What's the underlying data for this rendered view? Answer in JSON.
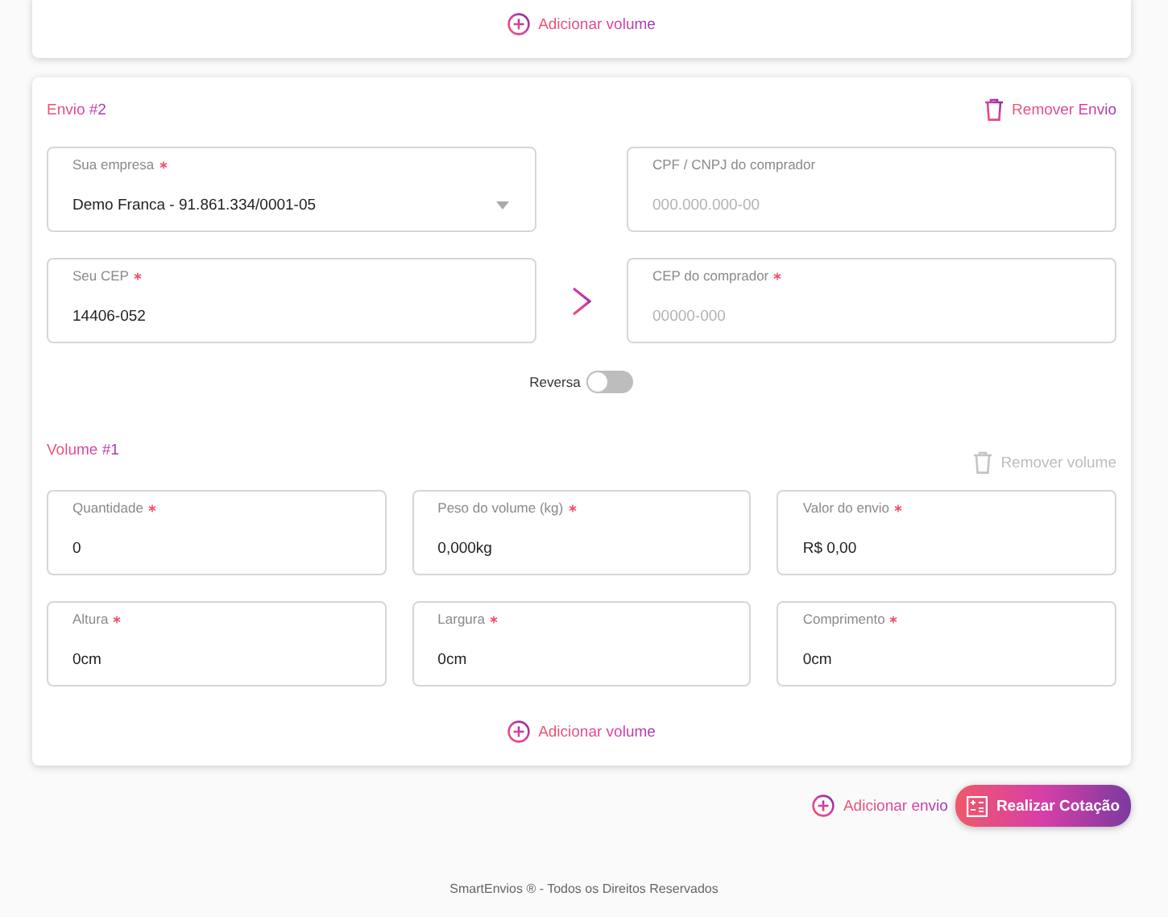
{
  "previous_card": {
    "add_volume": "Adicionar volume"
  },
  "shipment": {
    "title": "Envio #2",
    "remove": "Remover Envio",
    "route": [
      {
        "kind": "select",
        "label": "Sua empresa",
        "required": true,
        "value": "Demo Franca - 91.861.334/0001-05"
      },
      {
        "kind": "text",
        "label": "CPF / CNPJ do comprador",
        "required": false,
        "placeholder": "000.000.000-00"
      },
      {
        "kind": "text",
        "label": "Seu CEP",
        "required": true,
        "value": "14406-052"
      },
      {
        "kind": "text",
        "label": "CEP do comprador",
        "required": true,
        "placeholder": "00000-000"
      }
    ],
    "reverse": {
      "label": "Reversa",
      "on": false
    },
    "volume": {
      "title": "Volume #1",
      "remove": "Remover volume",
      "disabled": true,
      "fields": [
        {
          "label": "Quantidade",
          "required": true,
          "value": "0"
        },
        {
          "label": "Peso do volume (kg)",
          "required": true,
          "value": "0,000kg"
        },
        {
          "label": "Valor do envio",
          "required": true,
          "value": "R$ 0,00"
        },
        {
          "label": "Altura",
          "required": true,
          "value": "0cm"
        },
        {
          "label": "Largura",
          "required": true,
          "value": "0cm"
        },
        {
          "label": "Comprimento",
          "required": true,
          "value": "0cm"
        }
      ]
    },
    "add_volume": "Adicionar volume"
  },
  "add_shipment": "Adicionar envio",
  "quote_button": "Realizar Cotação",
  "footer": "SmartEnvios ® - Todos os Direitos Reservados"
}
